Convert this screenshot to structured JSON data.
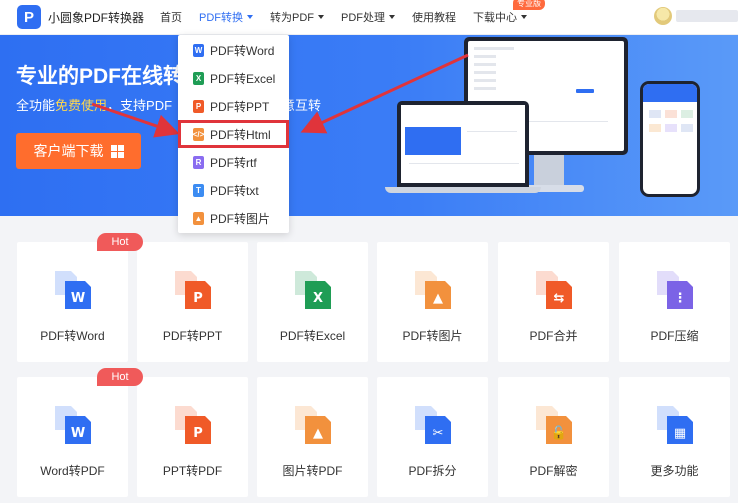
{
  "header": {
    "logo_mark": "P",
    "logo_text": "小圆象PDF转换器",
    "nav": [
      {
        "label": "首页",
        "active": false,
        "caret": false
      },
      {
        "label": "PDF转换",
        "active": true,
        "caret": true
      },
      {
        "label": "转为PDF",
        "active": false,
        "caret": true
      },
      {
        "label": "PDF处理",
        "active": false,
        "caret": true
      },
      {
        "label": "使用教程",
        "active": false,
        "caret": false
      },
      {
        "label": "下载中心",
        "active": false,
        "caret": true
      }
    ],
    "pro_badge": "专业版"
  },
  "hero": {
    "title": "专业的PDF在线转",
    "sub_prefix": "全功能",
    "sub_highlight": "免费使用",
    "sub_middle": "，支持PDF",
    "sub_end": "意互转",
    "download_button": "客户端下载"
  },
  "dropdown": {
    "items": [
      {
        "label": "PDF转Word",
        "icon": "word-icon",
        "color": "#2f6ef2",
        "letter": "W"
      },
      {
        "label": "PDF转Excel",
        "icon": "excel-icon",
        "color": "#1f9d55",
        "letter": "X"
      },
      {
        "label": "PDF转PPT",
        "icon": "ppt-icon",
        "color": "#f05a28",
        "letter": "P"
      },
      {
        "label": "PDF转Html",
        "icon": "html-icon",
        "color": "#f2913d",
        "letter": "</>"
      },
      {
        "label": "PDF转rtf",
        "icon": "rtf-icon",
        "color": "#8a6cf0",
        "letter": "R"
      },
      {
        "label": "PDF转txt",
        "icon": "txt-icon",
        "color": "#3c8cf2",
        "letter": "T"
      },
      {
        "label": "PDF转图片",
        "icon": "image-icon",
        "color": "#f2913d",
        "letter": "▲"
      }
    ],
    "selected_index": 3,
    "highlight_color": "#e0343b"
  },
  "tools_row1": [
    {
      "label": "PDF转Word",
      "icon": "pdf-to-word-icon",
      "color": "#2f6ef2",
      "letter": "W",
      "hot": true
    },
    {
      "label": "PDF转PPT",
      "icon": "pdf-to-ppt-icon",
      "color": "#f05a28",
      "letter": "P",
      "hot": false
    },
    {
      "label": "PDF转Excel",
      "icon": "pdf-to-excel-icon",
      "color": "#1f9d55",
      "letter": "X",
      "hot": false
    },
    {
      "label": "PDF转图片",
      "icon": "pdf-to-image-icon",
      "color": "#f2913d",
      "letter": "▲",
      "hot": false
    },
    {
      "label": "PDF合并",
      "icon": "pdf-merge-icon",
      "color": "#f05a28",
      "letter": "⇆",
      "hot": false
    },
    {
      "label": "PDF压缩",
      "icon": "pdf-compress-icon",
      "color": "#7b63e6",
      "letter": "⋮",
      "hot": false
    }
  ],
  "tools_row2": [
    {
      "label": "Word转PDF",
      "icon": "word-to-pdf-icon",
      "color": "#2f6ef2",
      "letter": "W",
      "hot": true
    },
    {
      "label": "PPT转PDF",
      "icon": "ppt-to-pdf-icon",
      "color": "#f05a28",
      "letter": "P",
      "hot": false
    },
    {
      "label": "图片转PDF",
      "icon": "image-to-pdf-icon",
      "color": "#f2913d",
      "letter": "▲",
      "hot": false
    },
    {
      "label": "PDF拆分",
      "icon": "pdf-split-icon",
      "color": "#2f6ef2",
      "letter": "✂",
      "hot": false
    },
    {
      "label": "PDF解密",
      "icon": "pdf-decrypt-icon",
      "color": "#f2913d",
      "letter": "🔓",
      "hot": false
    },
    {
      "label": "更多功能",
      "icon": "more-features-icon",
      "color": "#2f6ef2",
      "letter": "▦",
      "hot": false
    }
  ],
  "hot_label": "Hot"
}
